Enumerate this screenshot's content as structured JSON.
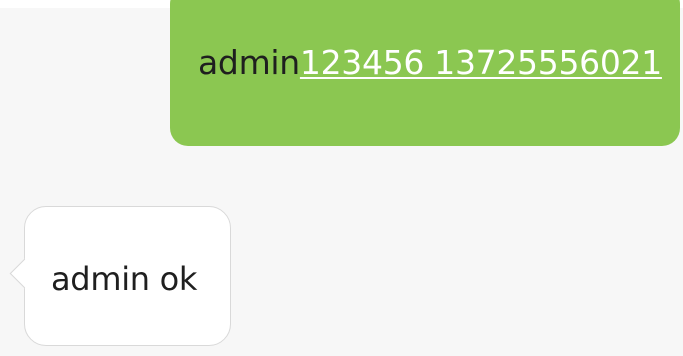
{
  "conversation": {
    "outgoing": {
      "prefix_text": "admin",
      "link_text": "123456 13725556021"
    },
    "incoming": {
      "text": "admin ok"
    }
  },
  "colors": {
    "outgoing_bubble": "#8bc751",
    "incoming_bubble": "#ffffff",
    "background": "#f7f7f7",
    "link_text": "#ffffff"
  }
}
